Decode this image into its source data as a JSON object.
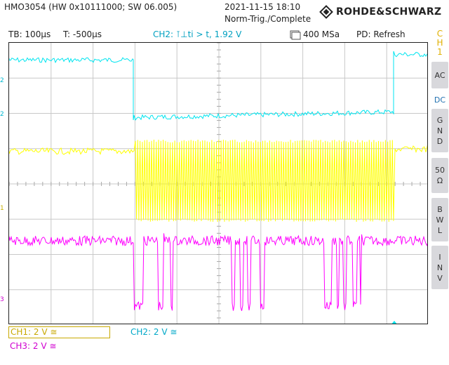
{
  "header": {
    "model": "HMO3054 (HW 0x10111000; SW 06.005)",
    "datetime": "2021-11-15 18:10",
    "trigger_status": "Norm-Trig./Complete",
    "brand": "ROHDE&SCHWARZ"
  },
  "infobar": {
    "timebase": "TB: 100µs",
    "time_offset": "T: -500µs",
    "trigger": "CH2: ⊺⊥ti > t, 1.92 V",
    "sample_rate": "400 MSa",
    "mode": "PD: Refresh"
  },
  "side_panel": {
    "channel": [
      "C",
      "H",
      "1"
    ],
    "keys": [
      {
        "lines": [
          "AC"
        ],
        "selected": false
      },
      {
        "lines": [
          "DC"
        ],
        "selected": true
      },
      {
        "lines": [
          "G",
          "N",
          "D"
        ],
        "selected": false
      },
      {
        "lines": [
          "50",
          "Ω"
        ],
        "selected": false
      },
      {
        "lines": [
          "B",
          "W",
          "L"
        ],
        "selected": false
      },
      {
        "lines": [
          "I",
          "N",
          "V"
        ],
        "selected": false
      }
    ]
  },
  "markers": {
    "ch2_top": "2",
    "ch2_ref": "2",
    "ch1_ref": "1",
    "ch3_ref": "3"
  },
  "channels": {
    "ch1": "CH1: 2 V ≅",
    "ch2": "CH2: 2 V ≅",
    "ch3": "CH3: 2 V ≅"
  },
  "colors": {
    "ch1": "#ffff00",
    "ch2": "#00e5f0",
    "ch3": "#ff00ff",
    "grid": "#c8c8c8"
  }
}
